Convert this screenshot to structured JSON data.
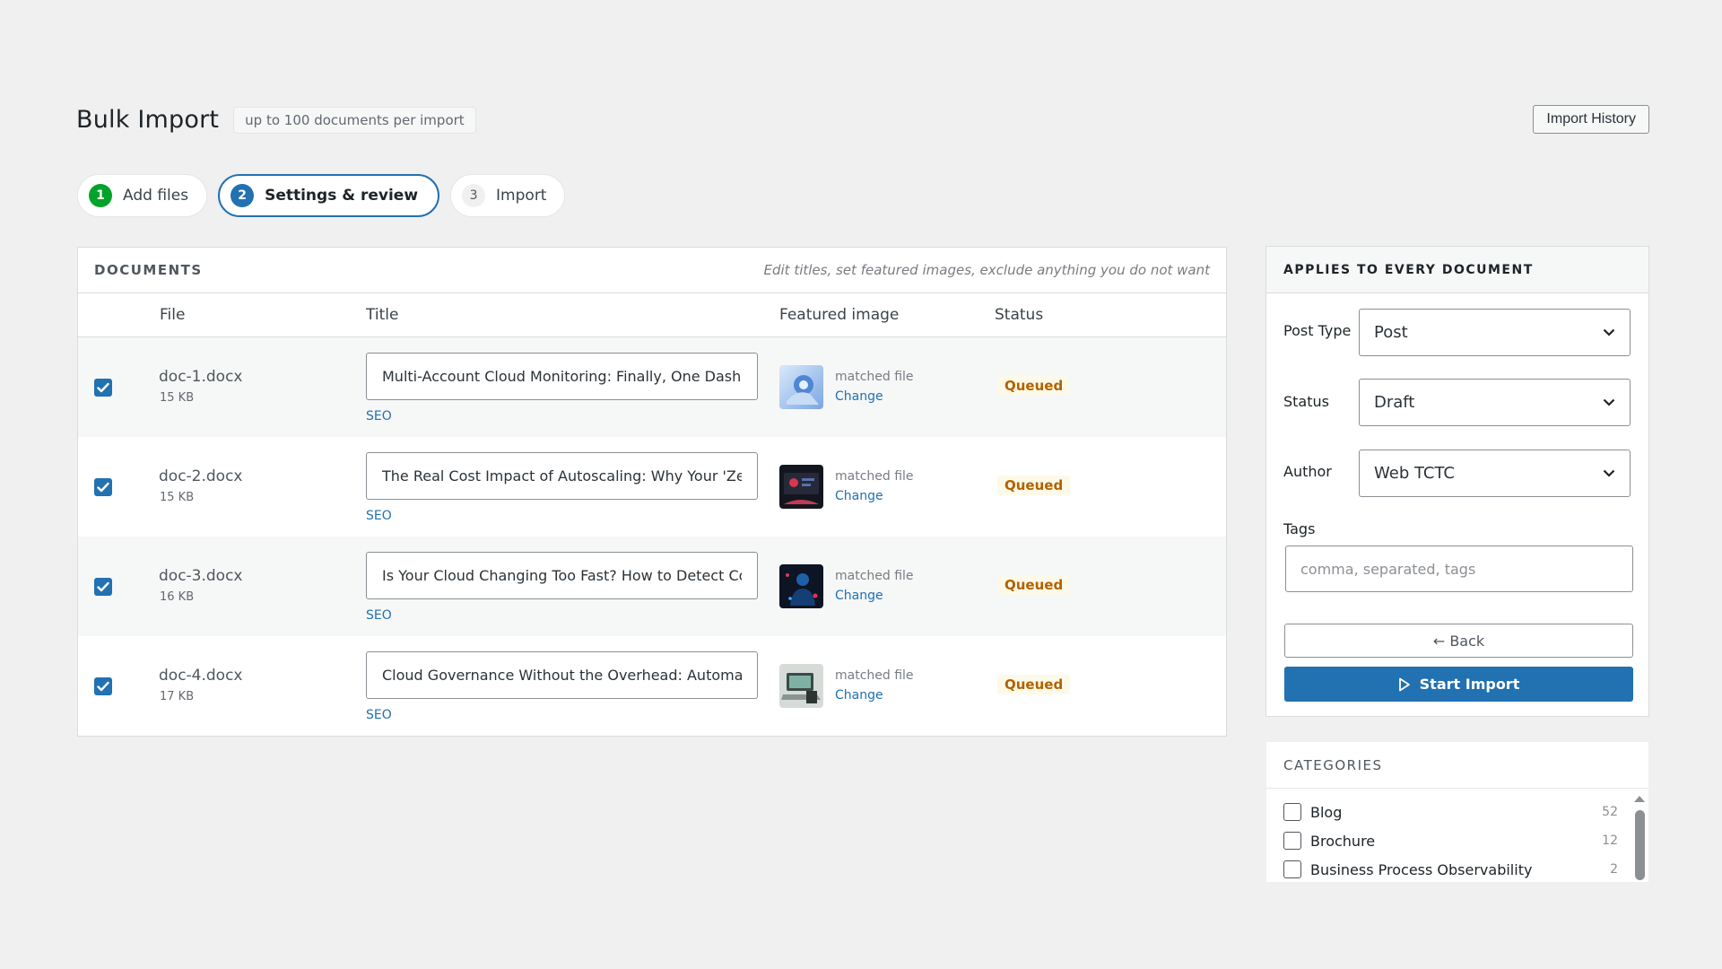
{
  "header": {
    "title": "Bulk Import",
    "hint": "up to 100 documents per import",
    "history_button": "Import History"
  },
  "steps": [
    {
      "num": "1",
      "label": "Add files",
      "state": "done"
    },
    {
      "num": "2",
      "label": "Settings & review",
      "state": "current"
    },
    {
      "num": "3",
      "label": "Import",
      "state": "pending"
    }
  ],
  "documents": {
    "heading": "DOCUMENTS",
    "hint": "Edit titles, set featured images, exclude anything you do not want",
    "columns": {
      "file": "File",
      "title": "Title",
      "image": "Featured image",
      "status": "Status"
    },
    "rows": [
      {
        "file": "doc-1.docx",
        "size": "15 KB",
        "title": "Multi-Account Cloud Monitoring: Finally, One Dashb",
        "seo": "SEO",
        "matched": "matched file",
        "change": "Change",
        "status": "Queued",
        "checked": true,
        "thumb_icon": "robot-hand-image"
      },
      {
        "file": "doc-2.docx",
        "size": "15 KB",
        "title": "The Real Cost Impact of Autoscaling: Why Your 'Zero",
        "seo": "SEO",
        "matched": "matched file",
        "change": "Change",
        "status": "Queued",
        "checked": true,
        "thumb_icon": "dark-dashboard-image"
      },
      {
        "file": "doc-3.docx",
        "size": "16 KB",
        "title": "Is Your Cloud Changing Too Fast? How to Detect Cor",
        "seo": "SEO",
        "matched": "matched file",
        "change": "Change",
        "status": "Queued",
        "checked": true,
        "thumb_icon": "neon-figure-image"
      },
      {
        "file": "doc-4.docx",
        "size": "17 KB",
        "title": "Cloud Governance Without the Overhead: Automate",
        "seo": "SEO",
        "matched": "matched file",
        "change": "Change",
        "status": "Queued",
        "checked": true,
        "thumb_icon": "laptop-desk-image"
      }
    ]
  },
  "settings": {
    "heading": "APPLIES TO EVERY DOCUMENT",
    "post_type": {
      "label": "Post Type",
      "value": "Post"
    },
    "status": {
      "label": "Status",
      "value": "Draft"
    },
    "author": {
      "label": "Author",
      "value": "Web TCTC"
    },
    "tags": {
      "label": "Tags",
      "placeholder": "comma, separated, tags"
    },
    "back_button": "← Back",
    "start_button": "Start Import"
  },
  "categories": {
    "heading": "CATEGORIES",
    "items": [
      {
        "label": "Blog",
        "count": "52"
      },
      {
        "label": "Brochure",
        "count": "12"
      },
      {
        "label": "Business Process Observability",
        "count": "2"
      }
    ]
  },
  "colors": {
    "accent": "#2271b1",
    "success": "#00a32a",
    "queued": "#b26200"
  }
}
